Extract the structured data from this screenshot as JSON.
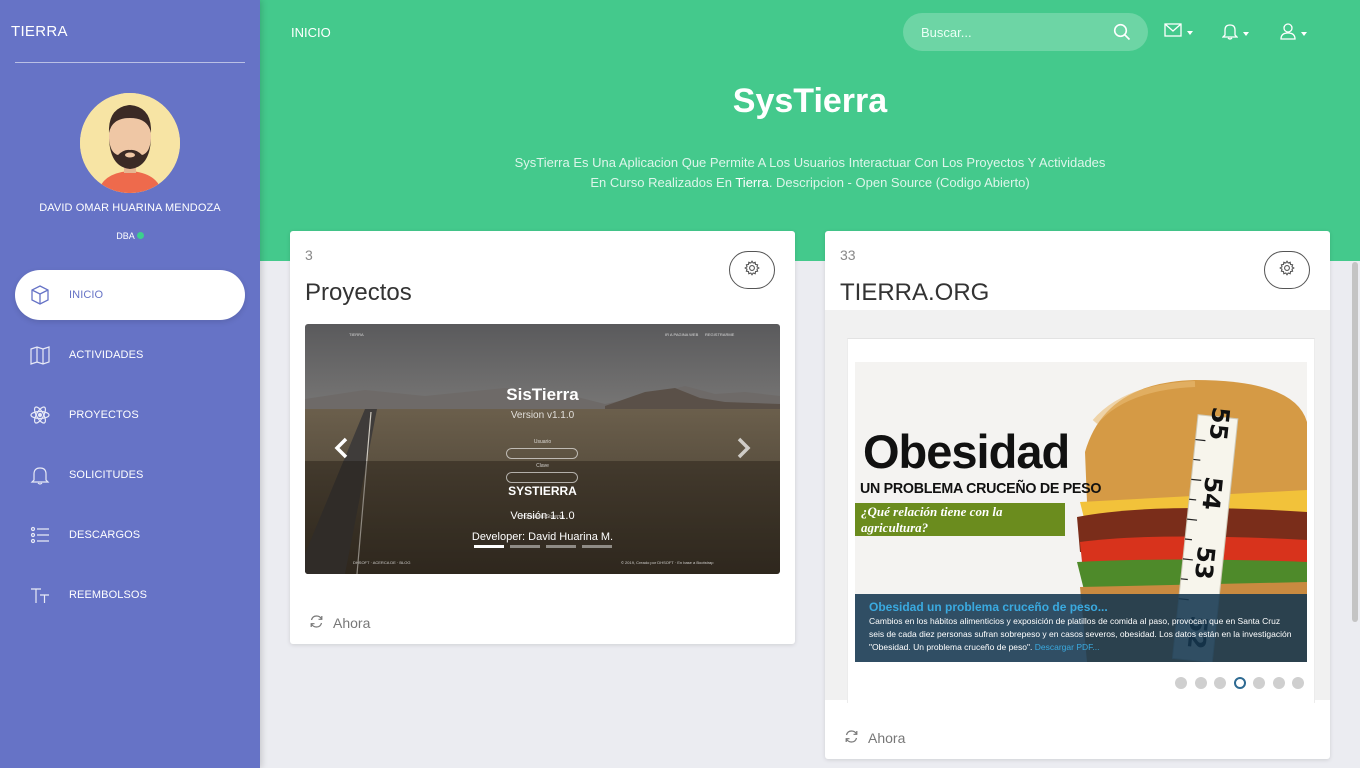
{
  "sidebar": {
    "brand": "TIERRA",
    "user_name": "DAVID OMAR HUARINA MENDOZA",
    "user_role": "DBA",
    "items": [
      {
        "label": "INICIO",
        "icon": "cube-icon"
      },
      {
        "label": "ACTIVIDADES",
        "icon": "map-icon"
      },
      {
        "label": "PROYECTOS",
        "icon": "atom-icon"
      },
      {
        "label": "SOLICITUDES",
        "icon": "bell-icon"
      },
      {
        "label": "DESCARGOS",
        "icon": "list-icon"
      },
      {
        "label": "REEMBOLSOS",
        "icon": "text-size-icon"
      }
    ]
  },
  "header": {
    "breadcrumb": "INICIO",
    "search_placeholder": "Buscar...",
    "hero_title": "SysTierra",
    "hero_desc_1": "SysTierra Es Una Aplicacion Que Permite A Los Usuarios Interactuar Con Los Proyectos Y Actividades En Curso Realizados En ",
    "hero_desc_highlight": "Tierra",
    "hero_desc_2": ". Descripcion - Open Source (Codigo Abierto)"
  },
  "card1": {
    "count": "3",
    "title": "Proyectos",
    "footer": "Ahora",
    "slide": {
      "nav_brand": "TIERRA",
      "nav_link1": "IR A PAGINA WEB",
      "nav_link2": "REGISTRARME",
      "app_name": "SisTierra",
      "app_version": "Version v1.1.0",
      "label_user": "Usuario",
      "label_pass": "Clave",
      "login_btn": "Ingresar al Sistema",
      "footer_links": "DHSOFT · ACERCA DE · BLOG",
      "footer_copy": "© 2019, Creado por DHSOFT · En base a Bootstrap",
      "caption_title": "SYSTIERRA",
      "caption_version": "Versión 1.1.0",
      "caption_dev": "Developer: David Huarina M."
    }
  },
  "card2": {
    "count": "33",
    "title": "TIERRA.ORG",
    "footer": "Ahora",
    "banner": {
      "headline": "Obesidad",
      "subhead": "UN PROBLEMA CRUCEÑO DE PESO",
      "question": "¿Qué relación tiene con la agricultura?",
      "tape_numbers": [
        "55",
        "54",
        "53",
        "52"
      ]
    },
    "caption_title": "Obesidad un problema cruceño de peso...",
    "caption_text": "Cambios en los hábitos alimenticios y exposición de platillos de comida al paso, provocan que en Santa Cruz seis de cada diez personas sufran sobrepeso y en casos severos, obesidad. Los datos están en la investigación \"Obesidad. Un problema cruceño de peso\". ",
    "caption_link": "Descargar PDF...",
    "dots_total": 7,
    "dots_active": 4
  }
}
